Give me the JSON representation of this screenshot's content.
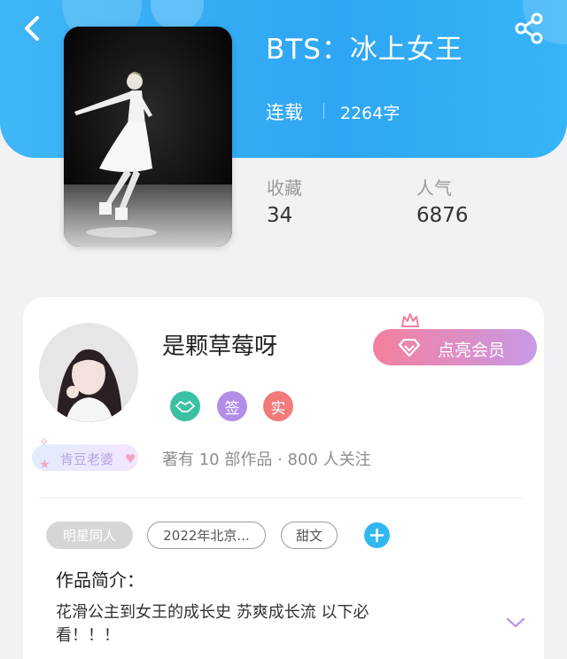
{
  "header": {
    "title": "BTS：冰上女王",
    "status": "连载",
    "word_count": "2264字",
    "gradient_start": "#3fb6f7",
    "gradient_end": "#36b4f8",
    "back_icon": "chevron-left-icon",
    "share_icon": "share-icon"
  },
  "stats": {
    "favorites_label": "收藏",
    "favorites_value": "34",
    "popularity_label": "人气",
    "popularity_value": "6876"
  },
  "author": {
    "name": "是颗草莓呀",
    "vip_button": "点亮会员",
    "badges": {
      "hand": "handshake-icon",
      "sign": "签",
      "real": "实"
    },
    "fan_tag": "肯豆老婆",
    "info": "著有 10 部作品 · 800 人关注"
  },
  "tags": {
    "tag1": "明星同人",
    "tag2": "2022年北京...",
    "tag3": "甜文",
    "add_icon": "plus-icon"
  },
  "intro": {
    "title": "作品简介：",
    "body": "花滑公主到女王的成长史 苏爽成长流 以下必看！！！",
    "expand_icon": "chevron-down-icon"
  },
  "colors": {
    "accent_blue": "#31b8f1",
    "vip_pink": "#f47f9d",
    "vip_purple": "#c89ae6",
    "badge_green": "#3bc0a4",
    "badge_purple": "#b38ee8",
    "badge_red": "#f37a7a"
  }
}
